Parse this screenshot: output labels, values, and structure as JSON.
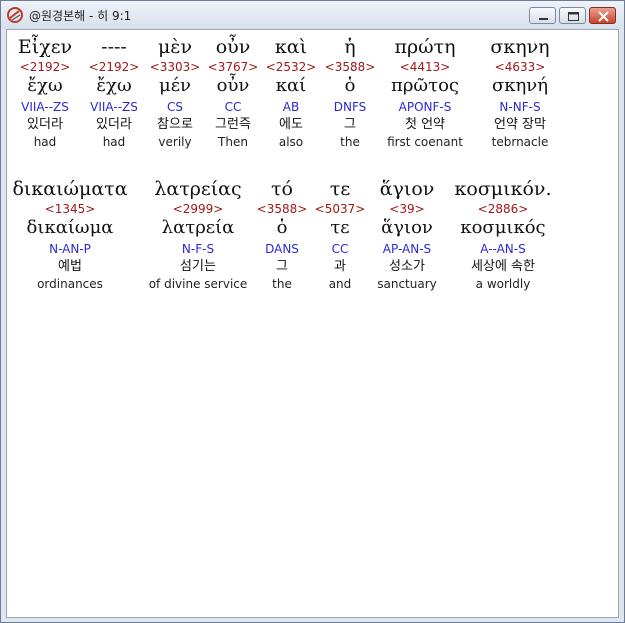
{
  "window": {
    "title": "@원경본해 - 히 9:1",
    "controls": {
      "minimize": "minimize",
      "maximize": "maximize",
      "close": "close"
    }
  },
  "rows": [
    {
      "words": [
        {
          "greek": "Εἶχεν",
          "num": "<2192>",
          "lemma": "ἔχω",
          "parse": "VIIA--ZS",
          "korean": "있더라",
          "english": "had"
        },
        {
          "greek": "----",
          "num": "<2192>",
          "lemma": "ἔχω",
          "parse": "VIIA--ZS",
          "korean": "있더라",
          "english": "had"
        },
        {
          "greek": "μὲν",
          "num": "<3303>",
          "lemma": "μέν",
          "parse": "CS",
          "korean": "참으로",
          "english": "verily"
        },
        {
          "greek": "οὖν",
          "num": "<3767>",
          "lemma": "οὖν",
          "parse": "CC",
          "korean": "그런즉",
          "english": "Then"
        },
        {
          "greek": "καὶ",
          "num": "<2532>",
          "lemma": "καί",
          "parse": "AB",
          "korean": "에도",
          "english": "also"
        },
        {
          "greek": "ἡ",
          "num": "<3588>",
          "lemma": "ὁ",
          "parse": "DNFS",
          "korean": "그",
          "english": "the"
        },
        {
          "greek": "πρώτη",
          "num": "<4413>",
          "lemma": "πρῶτος",
          "parse": "APONF-S",
          "korean": "첫 언약",
          "english": "first coenant"
        },
        {
          "greek": "σκηνη",
          "num": "<4633>",
          "lemma": "σκηνή",
          "parse": "N-NF-S",
          "korean": "언약 장막",
          "english": "tebrnacle"
        }
      ]
    },
    {
      "words": [
        {
          "greek": "δικαιώματα",
          "num": "<1345>",
          "lemma": "δικαίωμα",
          "parse": "N-AN-P",
          "korean": "예법",
          "english": "ordinances"
        },
        {
          "greek": "λατρείας",
          "num": "<2999>",
          "lemma": "λατρεία",
          "parse": "N-F-S",
          "korean": "섬기는",
          "english": "of divine service"
        },
        {
          "greek": "τό",
          "num": "<3588>",
          "lemma": "ὁ",
          "parse": "DANS",
          "korean": "그",
          "english": "the"
        },
        {
          "greek": "τε",
          "num": "<5037>",
          "lemma": "τε",
          "parse": "CC",
          "korean": "과",
          "english": "and"
        },
        {
          "greek": "ἅγιον",
          "num": "<39>",
          "lemma": "ἅγιον",
          "parse": "AP-AN-S",
          "korean": "성소가",
          "english": "sanctuary"
        },
        {
          "greek": "κοσμικόν.",
          "num": "<2886>",
          "lemma": "κοσμικός",
          "parse": "A--AN-S",
          "korean": "세상에 속한",
          "english": "a worldly"
        }
      ]
    }
  ]
}
